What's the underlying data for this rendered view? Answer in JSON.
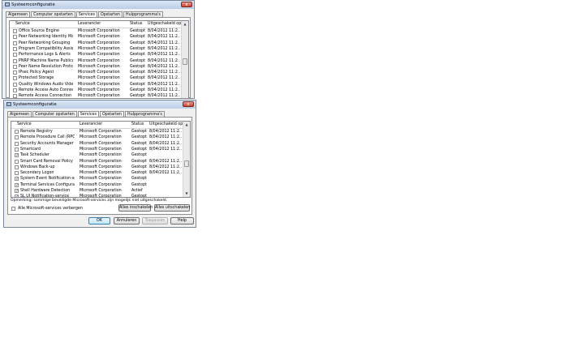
{
  "windows": [
    {
      "title": "Systeemconfiguratie",
      "tabs": [
        "Algemeen",
        "Computer opstarten",
        "Services",
        "Opstarten",
        "Hulpprogramma's"
      ],
      "active_tab": 2,
      "columns": [
        "Service",
        "Leverancier",
        "Status",
        "Uitgeschakeld op"
      ],
      "rows": [
        {
          "checked": false,
          "service": "Office Source Engine",
          "vendor": "Microsoft Corporation",
          "status": "Gestopt",
          "date": "8/04/2012 11:2..."
        },
        {
          "checked": false,
          "service": "Peer Networking Identity Manager",
          "vendor": "Microsoft Corporation",
          "status": "Gestopt",
          "date": "8/04/2012 11:2..."
        },
        {
          "checked": false,
          "service": "Peer Networking Grouping",
          "vendor": "Microsoft Corporation",
          "status": "Gestopt",
          "date": "8/04/2012 11:2..."
        },
        {
          "checked": false,
          "service": "Program Compatibility Assistant-...",
          "vendor": "Microsoft Corporation",
          "status": "Gestopt",
          "date": "8/04/2012 11:2..."
        },
        {
          "checked": false,
          "service": "Performance Logs & Alerts",
          "vendor": "Microsoft Corporation",
          "status": "Gestopt",
          "date": "8/04/2012 11:2..."
        },
        {
          "checked": false,
          "service": "PNRP Machine Name Publication-...",
          "vendor": "Microsoft Corporation",
          "status": "Gestopt",
          "date": "8/04/2012 11:2..."
        },
        {
          "checked": false,
          "service": "Peer Name Resolution Protocol",
          "vendor": "Microsoft Corporation",
          "status": "Gestopt",
          "date": "8/04/2012 11:2..."
        },
        {
          "checked": false,
          "service": "IPsec Policy Agent",
          "vendor": "Microsoft Corporation",
          "status": "Gestopt",
          "date": "8/04/2012 11:2..."
        },
        {
          "checked": false,
          "service": "Protected Storage",
          "vendor": "Microsoft Corporation",
          "status": "Gestopt",
          "date": "8/04/2012 11:2..."
        },
        {
          "checked": false,
          "service": "Quality Windows Audio Video Ex...",
          "vendor": "Microsoft Corporation",
          "status": "Gestopt",
          "date": "8/04/2012 11:2..."
        },
        {
          "checked": false,
          "service": "Remote Access Auto Connection...",
          "vendor": "Microsoft Corporation",
          "status": "Gestopt",
          "date": "8/04/2012 11:2..."
        },
        {
          "checked": false,
          "service": "Remote Access Connection Man...",
          "vendor": "Microsoft Corporation",
          "status": "Gestopt",
          "date": "8/04/2012 11:2..."
        }
      ]
    },
    {
      "title": "Systeemconfiguratie",
      "tabs": [
        "Algemeen",
        "Computer opstarten",
        "Services",
        "Opstarten",
        "Hulpprogramma's"
      ],
      "active_tab": 2,
      "columns": [
        "Service",
        "Leverancier",
        "Status",
        "Uitgeschakeld op"
      ],
      "rows": [
        {
          "checked": false,
          "service": "Remote Registry",
          "vendor": "Microsoft Corporation",
          "status": "Gestopt",
          "date": "8/04/2012 11:2..."
        },
        {
          "checked": false,
          "service": "Remote Procedure Call (RPC) Lo...",
          "vendor": "Microsoft Corporation",
          "status": "Gestopt",
          "date": "8/04/2012 11:2..."
        },
        {
          "checked": false,
          "service": "Security Accounts Manager",
          "vendor": "Microsoft Corporation",
          "status": "Gestopt",
          "date": "8/04/2012 11:2..."
        },
        {
          "checked": false,
          "service": "Smartcard",
          "vendor": "Microsoft Corporation",
          "status": "Gestopt",
          "date": "8/04/2012 11:2..."
        },
        {
          "checked": true,
          "service": "Task Scheduler",
          "vendor": "Microsoft Corporation",
          "status": "Gestopt",
          "date": ""
        },
        {
          "checked": false,
          "service": "Smart Card Removal Policy",
          "vendor": "Microsoft Corporation",
          "status": "Gestopt",
          "date": "8/04/2012 11:2..."
        },
        {
          "checked": false,
          "service": "Windows Back-up",
          "vendor": "Microsoft Corporation",
          "status": "Gestopt",
          "date": "8/04/2012 11:2..."
        },
        {
          "checked": false,
          "service": "Secondary Logon",
          "vendor": "Microsoft Corporation",
          "status": "Gestopt",
          "date": "8/04/2012 11:2..."
        },
        {
          "checked": true,
          "service": "System Event Notification-service",
          "vendor": "Microsoft Corporation",
          "status": "Gestopt",
          "date": ""
        },
        {
          "checked": true,
          "service": "Terminal Services Configuration",
          "vendor": "Microsoft Corporation",
          "status": "Gestopt",
          "date": ""
        },
        {
          "checked": true,
          "service": "Shell Hardware Detection",
          "vendor": "Microsoft Corporation",
          "status": "Actief",
          "date": ""
        },
        {
          "checked": true,
          "service": "SL UI Notification-service",
          "vendor": "Microsoft Corporation",
          "status": "Gestopt",
          "date": ""
        }
      ],
      "note": "Opmerking: sommige beveiligde Microsoft-services zijn mogelijk niet uitgeschakeld.",
      "enable_all": "Alles inschakelen",
      "disable_all": "Alles uitschakelen",
      "hide_ms_label": "Alle Microsoft-services verbergen",
      "hide_ms_checked": false,
      "buttons": {
        "ok": "OK",
        "cancel": "Annuleren",
        "apply": "Toepassen",
        "help": "Help"
      }
    }
  ],
  "glyphs": {
    "close": "x",
    "check": "✓",
    "scroll_up": "▲",
    "scroll_down": "▼"
  }
}
